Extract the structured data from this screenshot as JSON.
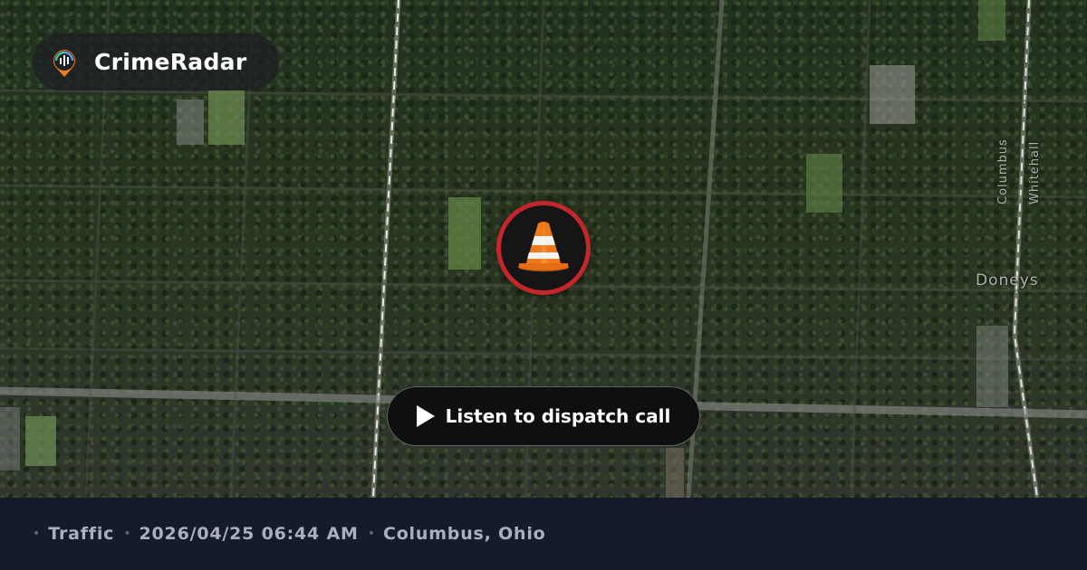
{
  "brand": {
    "name": "CrimeRadar",
    "logo_icon": "radar-pin-icon"
  },
  "map": {
    "labels": {
      "columbus": "Columbus",
      "whitehall": "Whitehall",
      "doneys": "Doneys"
    }
  },
  "incident": {
    "icon": "traffic-cone-icon",
    "ring_color": "#c4262c"
  },
  "action": {
    "label": "Listen to dispatch call",
    "icon": "play-icon"
  },
  "footer": {
    "category": "Traffic",
    "datetime": "2026/04/25 06:44 AM",
    "location": "Columbus, Ohio",
    "separator": "•"
  },
  "colors": {
    "footer_bg": "#151b2b",
    "footer_text": "#aab0bd",
    "accent_orange": "#f07a1a"
  }
}
